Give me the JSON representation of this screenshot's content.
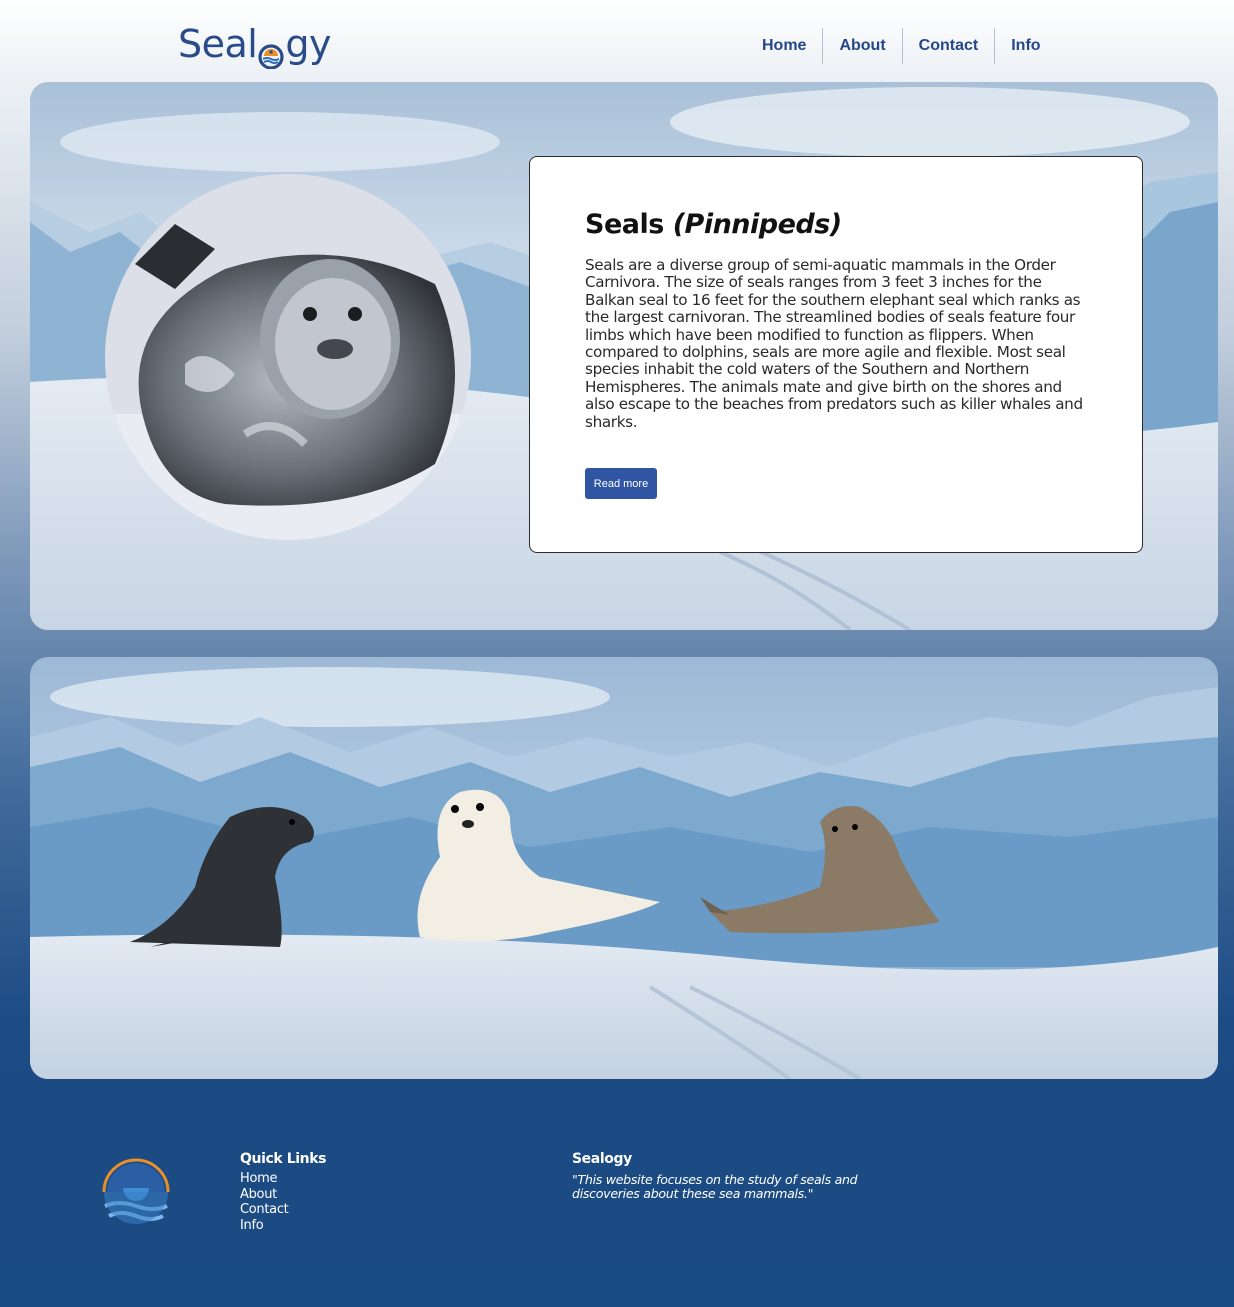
{
  "header": {
    "logo_prefix": "Seal",
    "logo_suffix": "gy",
    "nav": [
      {
        "label": "Home"
      },
      {
        "label": "About"
      },
      {
        "label": "Contact"
      },
      {
        "label": "Info"
      }
    ]
  },
  "hero": {
    "title": "Seals ",
    "title_italic": "(Pinnipeds)",
    "body": "Seals are a diverse group of semi-aquatic mammals in the Order Carnivora. The size of seals ranges from 3 feet 3 inches for the Balkan seal to 16 feet for the southern elephant seal which ranks as the largest carnivoran. The streamlined bodies of seals feature four limbs which have been modified to function as flippers. When compared to dolphins, seals are more agile and flexible. Most seal species inhabit the cold waters of the Southern and Northern Hemispheres. The animals mate and give birth on the shores and also escape to the beaches from predators such as killer whales and sharks.",
    "button": "Read more"
  },
  "footer": {
    "quick_links_title": "Quick Links",
    "links": [
      {
        "label": "Home"
      },
      {
        "label": "About"
      },
      {
        "label": "Contact"
      },
      {
        "label": "Info"
      }
    ],
    "brand_title": "Sealogy",
    "tagline": "\"This website focuses on the study of seals and discoveries about these sea mammals.\""
  },
  "colors": {
    "brand_blue": "#294b8a",
    "button_blue": "#2f55a3",
    "footer_blue": "#1b4b83",
    "logo_orange": "#e8902a"
  },
  "icons": {
    "logo_mark": "sun-over-sea-icon",
    "footer_logo": "sun-over-waves-icon"
  }
}
